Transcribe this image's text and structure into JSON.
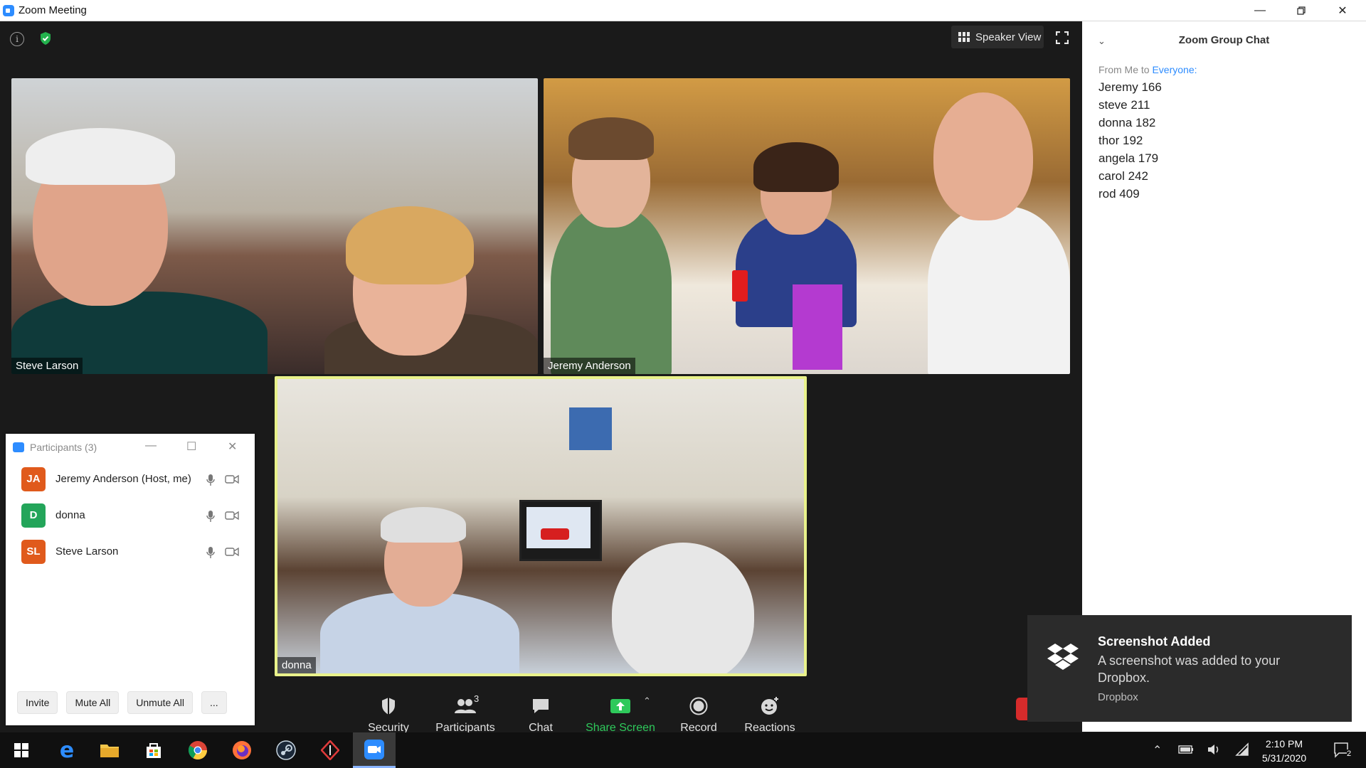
{
  "window": {
    "title": "Zoom Meeting",
    "controls": [
      "minimize",
      "restore",
      "close"
    ]
  },
  "meeting": {
    "view_button": "Speaker View",
    "tiles": [
      {
        "name": "Steve Larson"
      },
      {
        "name": "Jeremy Anderson"
      },
      {
        "name": "donna",
        "active_speaker": true
      }
    ]
  },
  "toolbar": {
    "security": "Security",
    "participants": "Participants",
    "participants_count": "3",
    "chat": "Chat",
    "share_screen": "Share Screen",
    "record": "Record",
    "reactions": "Reactions"
  },
  "participants_panel": {
    "title": "Participants (3)",
    "people": [
      {
        "initials": "JA",
        "name": "Jeremy Anderson (Host, me)",
        "color": "#e05a1c"
      },
      {
        "initials": "D",
        "name": "donna",
        "color": "#23a55a"
      },
      {
        "initials": "SL",
        "name": "Steve Larson",
        "color": "#e05a1c"
      }
    ],
    "buttons": {
      "invite": "Invite",
      "mute_all": "Mute All",
      "unmute_all": "Unmute All",
      "more": "..."
    }
  },
  "chat": {
    "title": "Zoom Group Chat",
    "from_prefix": "From Me to",
    "to": "Everyone:",
    "messages": [
      "Jeremy 166",
      "steve 211",
      "donna 182",
      "thor 192",
      "angela 179",
      "carol 242",
      "rod 409"
    ]
  },
  "toast": {
    "title": "Screenshot Added",
    "body": "A screenshot was added to your Dropbox.",
    "source": "Dropbox"
  },
  "taskbar": {
    "time": "2:10 PM",
    "date": "5/31/2020",
    "notification_count": "2"
  },
  "colors": {
    "accent_blue": "#2d8cff",
    "share_green": "#2ec95b",
    "active_speaker_border": "#e9f28b"
  }
}
